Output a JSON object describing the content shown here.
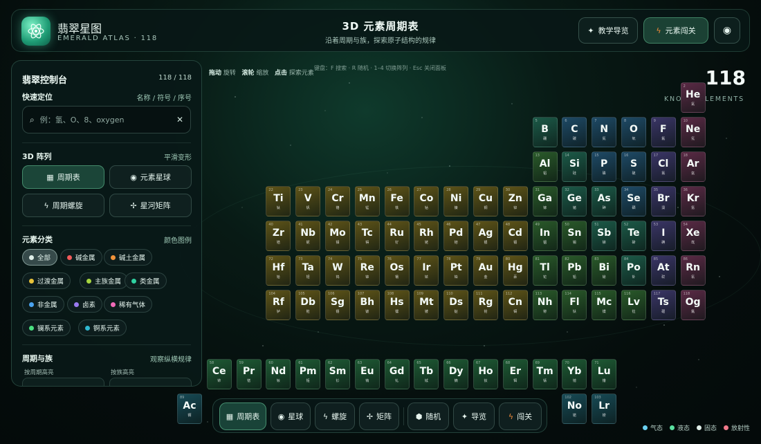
{
  "brand": {
    "name": "翡翠星图",
    "sub": "EMERALD ATLAS · 118"
  },
  "header": {
    "title": "3D 元素周期表",
    "subtitle": "沿着周期与族，探索原子结构的规律",
    "guide_label": "教学导览",
    "quest_label": "元素闯关"
  },
  "panel": {
    "title": "翡翠控制台",
    "count": "118 / 118",
    "locate_title": "快速定位",
    "locate_note": "名称 / 符号 / 序号",
    "search_placeholder": "例：氢、O、8、oxygen",
    "layout_title": "3D 阵列",
    "layout_note": "平滑变形",
    "layouts": [
      "周期表",
      "元素星球",
      "周期螺旋",
      "星河矩阵"
    ],
    "category_title": "元素分类",
    "category_note": "颜色图例",
    "categories": [
      {
        "label": "全部",
        "color": "#dfeee8"
      },
      {
        "label": "碱金属",
        "color": "#f05a5a"
      },
      {
        "label": "碱土金属",
        "color": "#f0923a"
      },
      {
        "label": "过渡金属",
        "color": "#e8c23a"
      },
      {
        "label": "主族金属",
        "color": "#a6d640"
      },
      {
        "label": "类金属",
        "color": "#2fd0a0"
      },
      {
        "label": "非金属",
        "color": "#4aa3f0"
      },
      {
        "label": "卤素",
        "color": "#9a7af0"
      },
      {
        "label": "稀有气体",
        "color": "#f06ab8"
      },
      {
        "label": "镧系元素",
        "color": "#4adf80"
      },
      {
        "label": "锕系元素",
        "color": "#2fb8d0"
      }
    ],
    "period_title": "周期与族",
    "period_note": "观察纵横规律",
    "period_label": "按周期高亮",
    "group_label": "按族高亮"
  },
  "stage": {
    "hint_drag": "拖动",
    "hint_drag_text": "旋转",
    "hint_wheel": "滚轮",
    "hint_wheel_text": "缩放",
    "hint_click": "点击",
    "hint_click_text": "探索元素",
    "hint_keys": "键盘：F 搜索 · R 随机 · 1–4 切换阵列 · Esc 关闭面板",
    "count": "118",
    "known": "KNOWN ELEMENTS"
  },
  "dock": [
    "周期表",
    "星球",
    "螺旋",
    "矩阵",
    "随机",
    "导览",
    "闯关"
  ],
  "states": [
    {
      "label": "气态",
      "color": "#6ad0f0"
    },
    {
      "label": "液态",
      "color": "#5ae0a0"
    },
    {
      "label": "固态",
      "color": "#dfeee8"
    },
    {
      "label": "放射性",
      "color": "#f07a8a"
    }
  ],
  "colors": {
    "accent": "#2fd0a0",
    "bg": "#050d0c"
  },
  "elements": [
    {
      "s": "He",
      "n": 2,
      "c": "氦",
      "r": 0,
      "col": 17,
      "k": "noble"
    },
    {
      "s": "B",
      "n": 5,
      "c": "硼",
      "r": 1,
      "col": 12,
      "k": "metalloid"
    },
    {
      "s": "C",
      "n": 6,
      "c": "碳",
      "r": 1,
      "col": 13,
      "k": "nonmetal"
    },
    {
      "s": "N",
      "n": 7,
      "c": "氮",
      "r": 1,
      "col": 14,
      "k": "nonmetal"
    },
    {
      "s": "O",
      "n": 8,
      "c": "氧",
      "r": 1,
      "col": 15,
      "k": "nonmetal"
    },
    {
      "s": "F",
      "n": 9,
      "c": "氟",
      "r": 1,
      "col": 16,
      "k": "halogen"
    },
    {
      "s": "Ne",
      "n": 10,
      "c": "氖",
      "r": 1,
      "col": 17,
      "k": "noble"
    },
    {
      "s": "Al",
      "n": 13,
      "c": "铝",
      "r": 2,
      "col": 12,
      "k": "post"
    },
    {
      "s": "Si",
      "n": 14,
      "c": "硅",
      "r": 2,
      "col": 13,
      "k": "metalloid"
    },
    {
      "s": "P",
      "n": 15,
      "c": "磷",
      "r": 2,
      "col": 14,
      "k": "nonmetal"
    },
    {
      "s": "S",
      "n": 16,
      "c": "硫",
      "r": 2,
      "col": 15,
      "k": "nonmetal"
    },
    {
      "s": "Cl",
      "n": 17,
      "c": "氯",
      "r": 2,
      "col": 16,
      "k": "halogen"
    },
    {
      "s": "Ar",
      "n": 18,
      "c": "氩",
      "r": 2,
      "col": 17,
      "k": "noble"
    },
    {
      "s": "Ti",
      "n": 22,
      "c": "钛",
      "r": 3,
      "col": 3,
      "k": "transition"
    },
    {
      "s": "V",
      "n": 23,
      "c": "钒",
      "r": 3,
      "col": 4,
      "k": "transition"
    },
    {
      "s": "Cr",
      "n": 24,
      "c": "铬",
      "r": 3,
      "col": 5,
      "k": "transition"
    },
    {
      "s": "Mn",
      "n": 25,
      "c": "锰",
      "r": 3,
      "col": 6,
      "k": "transition"
    },
    {
      "s": "Fe",
      "n": 26,
      "c": "铁",
      "r": 3,
      "col": 7,
      "k": "transition"
    },
    {
      "s": "Co",
      "n": 27,
      "c": "钴",
      "r": 3,
      "col": 8,
      "k": "transition"
    },
    {
      "s": "Ni",
      "n": 28,
      "c": "镍",
      "r": 3,
      "col": 9,
      "k": "transition"
    },
    {
      "s": "Cu",
      "n": 29,
      "c": "铜",
      "r": 3,
      "col": 10,
      "k": "transition"
    },
    {
      "s": "Zn",
      "n": 30,
      "c": "锌",
      "r": 3,
      "col": 11,
      "k": "transition"
    },
    {
      "s": "Ga",
      "n": 31,
      "c": "镓",
      "r": 3,
      "col": 12,
      "k": "post"
    },
    {
      "s": "Ge",
      "n": 32,
      "c": "锗",
      "r": 3,
      "col": 13,
      "k": "metalloid"
    },
    {
      "s": "As",
      "n": 33,
      "c": "砷",
      "r": 3,
      "col": 14,
      "k": "metalloid"
    },
    {
      "s": "Se",
      "n": 34,
      "c": "硒",
      "r": 3,
      "col": 15,
      "k": "nonmetal"
    },
    {
      "s": "Br",
      "n": 35,
      "c": "溴",
      "r": 3,
      "col": 16,
      "k": "halogen"
    },
    {
      "s": "Kr",
      "n": 36,
      "c": "氪",
      "r": 3,
      "col": 17,
      "k": "noble"
    },
    {
      "s": "Zr",
      "n": 40,
      "c": "锆",
      "r": 4,
      "col": 3,
      "k": "transition"
    },
    {
      "s": "Nb",
      "n": 41,
      "c": "铌",
      "r": 4,
      "col": 4,
      "k": "transition"
    },
    {
      "s": "Mo",
      "n": 42,
      "c": "钼",
      "r": 4,
      "col": 5,
      "k": "transition"
    },
    {
      "s": "Tc",
      "n": 43,
      "c": "锝",
      "r": 4,
      "col": 6,
      "k": "transition"
    },
    {
      "s": "Ru",
      "n": 44,
      "c": "钌",
      "r": 4,
      "col": 7,
      "k": "transition"
    },
    {
      "s": "Rh",
      "n": 45,
      "c": "铑",
      "r": 4,
      "col": 8,
      "k": "transition"
    },
    {
      "s": "Pd",
      "n": 46,
      "c": "钯",
      "r": 4,
      "col": 9,
      "k": "transition"
    },
    {
      "s": "Ag",
      "n": 47,
      "c": "银",
      "r": 4,
      "col": 10,
      "k": "transition"
    },
    {
      "s": "Cd",
      "n": 48,
      "c": "镉",
      "r": 4,
      "col": 11,
      "k": "transition"
    },
    {
      "s": "In",
      "n": 49,
      "c": "铟",
      "r": 4,
      "col": 12,
      "k": "post"
    },
    {
      "s": "Sn",
      "n": 50,
      "c": "锡",
      "r": 4,
      "col": 13,
      "k": "post"
    },
    {
      "s": "Sb",
      "n": 51,
      "c": "锑",
      "r": 4,
      "col": 14,
      "k": "metalloid"
    },
    {
      "s": "Te",
      "n": 52,
      "c": "碲",
      "r": 4,
      "col": 15,
      "k": "metalloid"
    },
    {
      "s": "I",
      "n": 53,
      "c": "碘",
      "r": 4,
      "col": 16,
      "k": "halogen"
    },
    {
      "s": "Xe",
      "n": 54,
      "c": "氙",
      "r": 4,
      "col": 17,
      "k": "noble"
    },
    {
      "s": "Hf",
      "n": 72,
      "c": "铪",
      "r": 5,
      "col": 3,
      "k": "transition"
    },
    {
      "s": "Ta",
      "n": 73,
      "c": "钽",
      "r": 5,
      "col": 4,
      "k": "transition"
    },
    {
      "s": "W",
      "n": 74,
      "c": "钨",
      "r": 5,
      "col": 5,
      "k": "transition"
    },
    {
      "s": "Re",
      "n": 75,
      "c": "铼",
      "r": 5,
      "col": 6,
      "k": "transition"
    },
    {
      "s": "Os",
      "n": 76,
      "c": "锇",
      "r": 5,
      "col": 7,
      "k": "transition"
    },
    {
      "s": "Ir",
      "n": 77,
      "c": "铱",
      "r": 5,
      "col": 8,
      "k": "transition"
    },
    {
      "s": "Pt",
      "n": 78,
      "c": "铂",
      "r": 5,
      "col": 9,
      "k": "transition"
    },
    {
      "s": "Au",
      "n": 79,
      "c": "金",
      "r": 5,
      "col": 10,
      "k": "transition"
    },
    {
      "s": "Hg",
      "n": 80,
      "c": "汞",
      "r": 5,
      "col": 11,
      "k": "transition"
    },
    {
      "s": "Tl",
      "n": 81,
      "c": "铊",
      "r": 5,
      "col": 12,
      "k": "post"
    },
    {
      "s": "Pb",
      "n": 82,
      "c": "铅",
      "r": 5,
      "col": 13,
      "k": "post"
    },
    {
      "s": "Bi",
      "n": 83,
      "c": "铋",
      "r": 5,
      "col": 14,
      "k": "post"
    },
    {
      "s": "Po",
      "n": 84,
      "c": "钋",
      "r": 5,
      "col": 15,
      "k": "metalloid"
    },
    {
      "s": "At",
      "n": 85,
      "c": "砹",
      "r": 5,
      "col": 16,
      "k": "halogen"
    },
    {
      "s": "Rn",
      "n": 86,
      "c": "氡",
      "r": 5,
      "col": 17,
      "k": "noble"
    },
    {
      "s": "Rf",
      "n": 104,
      "c": "𬬻",
      "r": 6,
      "col": 3,
      "k": "transition"
    },
    {
      "s": "Db",
      "n": 105,
      "c": "𬭊",
      "r": 6,
      "col": 4,
      "k": "transition"
    },
    {
      "s": "Sg",
      "n": 106,
      "c": "𬭳",
      "r": 6,
      "col": 5,
      "k": "transition"
    },
    {
      "s": "Bh",
      "n": 107,
      "c": "𬭛",
      "r": 6,
      "col": 6,
      "k": "transition"
    },
    {
      "s": "Hs",
      "n": 108,
      "c": "𬭶",
      "r": 6,
      "col": 7,
      "k": "transition"
    },
    {
      "s": "Mt",
      "n": 109,
      "c": "鿏",
      "r": 6,
      "col": 8,
      "k": "transition"
    },
    {
      "s": "Ds",
      "n": 110,
      "c": "𫟼",
      "r": 6,
      "col": 9,
      "k": "transition"
    },
    {
      "s": "Rg",
      "n": 111,
      "c": "𬬭",
      "r": 6,
      "col": 10,
      "k": "transition"
    },
    {
      "s": "Cn",
      "n": 112,
      "c": "鿔",
      "r": 6,
      "col": 11,
      "k": "transition"
    },
    {
      "s": "Nh",
      "n": 113,
      "c": "鿭",
      "r": 6,
      "col": 12,
      "k": "post"
    },
    {
      "s": "Fl",
      "n": 114,
      "c": "𫓧",
      "r": 6,
      "col": 13,
      "k": "post"
    },
    {
      "s": "Mc",
      "n": 115,
      "c": "镆",
      "r": 6,
      "col": 14,
      "k": "post"
    },
    {
      "s": "Lv",
      "n": 116,
      "c": "𫟷",
      "r": 6,
      "col": 15,
      "k": "post"
    },
    {
      "s": "Ts",
      "n": 117,
      "c": "鿬",
      "r": 6,
      "col": 16,
      "k": "halogen"
    },
    {
      "s": "Og",
      "n": 118,
      "c": "鿫",
      "r": 6,
      "col": 17,
      "k": "noble"
    },
    {
      "s": "Ce",
      "n": 58,
      "c": "铈",
      "r": 8,
      "col": 1,
      "k": "lanth"
    },
    {
      "s": "Pr",
      "n": 59,
      "c": "镨",
      "r": 8,
      "col": 2,
      "k": "lanth"
    },
    {
      "s": "Nd",
      "n": 60,
      "c": "钕",
      "r": 8,
      "col": 3,
      "k": "lanth"
    },
    {
      "s": "Pm",
      "n": 61,
      "c": "钷",
      "r": 8,
      "col": 4,
      "k": "lanth"
    },
    {
      "s": "Sm",
      "n": 62,
      "c": "钐",
      "r": 8,
      "col": 5,
      "k": "lanth"
    },
    {
      "s": "Eu",
      "n": 63,
      "c": "铕",
      "r": 8,
      "col": 6,
      "k": "lanth"
    },
    {
      "s": "Gd",
      "n": 64,
      "c": "钆",
      "r": 8,
      "col": 7,
      "k": "lanth"
    },
    {
      "s": "Tb",
      "n": 65,
      "c": "铽",
      "r": 8,
      "col": 8,
      "k": "lanth"
    },
    {
      "s": "Dy",
      "n": 66,
      "c": "镝",
      "r": 8,
      "col": 9,
      "k": "lanth"
    },
    {
      "s": "Ho",
      "n": 67,
      "c": "钬",
      "r": 8,
      "col": 10,
      "k": "lanth"
    },
    {
      "s": "Er",
      "n": 68,
      "c": "铒",
      "r": 8,
      "col": 11,
      "k": "lanth"
    },
    {
      "s": "Tm",
      "n": 69,
      "c": "铥",
      "r": 8,
      "col": 12,
      "k": "lanth"
    },
    {
      "s": "Yb",
      "n": 70,
      "c": "镱",
      "r": 8,
      "col": 13,
      "k": "lanth"
    },
    {
      "s": "Lu",
      "n": 71,
      "c": "镥",
      "r": 8,
      "col": 14,
      "k": "lanth"
    },
    {
      "s": "Ac",
      "n": 89,
      "c": "锕",
      "r": 9,
      "col": 0,
      "k": "actin"
    },
    {
      "s": "No",
      "n": 102,
      "c": "锘",
      "r": 9,
      "col": 13,
      "k": "actin"
    },
    {
      "s": "Lr",
      "n": 103,
      "c": "铹",
      "r": 9,
      "col": 14,
      "k": "actin"
    }
  ],
  "element_colors": {
    "noble": "#5a2a45",
    "metalloid": "#1c5a48",
    "nonmetal": "#1e4a66",
    "halogen": "#3a3566",
    "post": "#2a5a2a",
    "transition": "#5e5418",
    "lanth": "#1e5a34",
    "actin": "#174a55"
  }
}
